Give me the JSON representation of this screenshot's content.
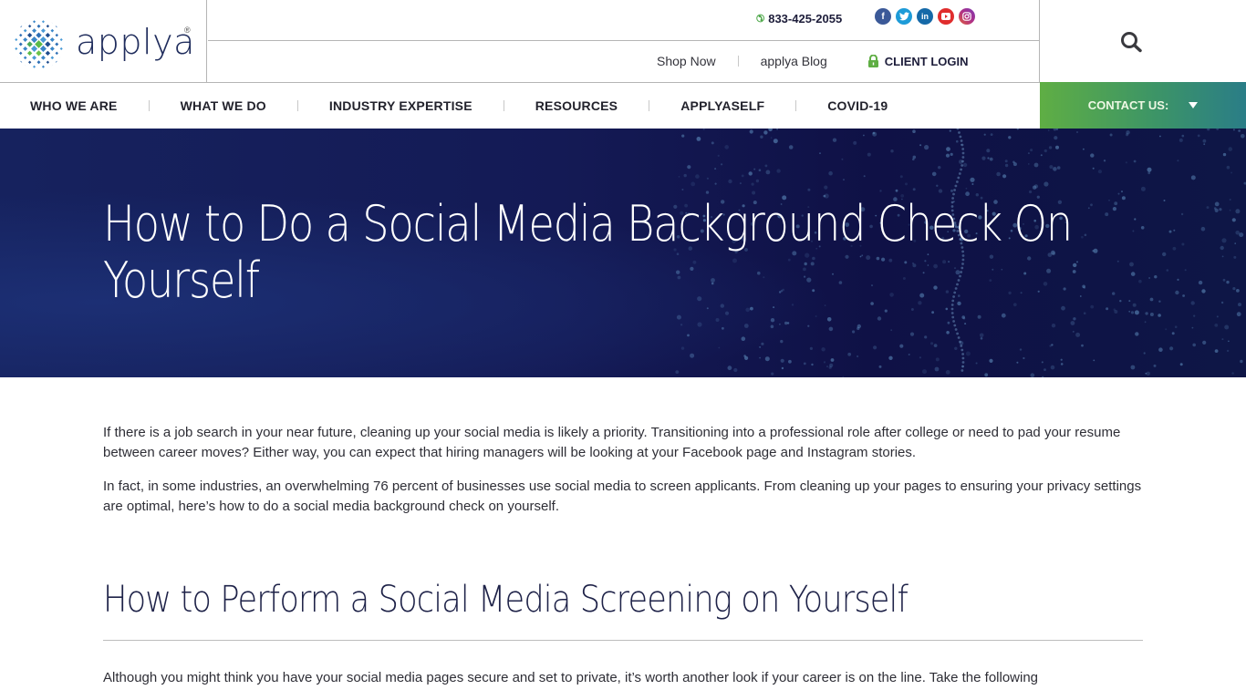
{
  "brand": {
    "name": "applya",
    "registered_mark": "®",
    "colors": {
      "navy": "#1f2c5c",
      "green": "#5fae44",
      "teal": "#2a7d87",
      "hero_dark": "#0f1146"
    }
  },
  "utility": {
    "phone_icon": "phone-icon",
    "phone": "833-425-2055",
    "socials": [
      {
        "name": "facebook",
        "glyph": "f",
        "color": "#3b5998"
      },
      {
        "name": "twitter",
        "glyph": "t",
        "color": "#1da1f2"
      },
      {
        "name": "linkedin",
        "glyph": "in",
        "color": "#0e76a8"
      },
      {
        "name": "youtube",
        "glyph": "▶",
        "color": "#e52d27"
      },
      {
        "name": "instagram",
        "glyph": "◎",
        "color": "#8a3ab9"
      }
    ],
    "links": [
      {
        "label": "Shop Now"
      },
      {
        "label": "applya Blog"
      }
    ],
    "client_login": "CLIENT LOGIN"
  },
  "nav": {
    "items": [
      {
        "label": "WHO WE ARE"
      },
      {
        "label": "WHAT WE DO"
      },
      {
        "label": "INDUSTRY EXPERTISE"
      },
      {
        "label": "RESOURCES"
      },
      {
        "label": "APPLYASELF"
      },
      {
        "label": "COVID-19"
      }
    ],
    "contact_label": "CONTACT US:"
  },
  "hero": {
    "title": "How to Do a Social Media Background Check On Yourself"
  },
  "article": {
    "paragraphs": [
      "If there is a job search in your near future, cleaning up your social media is likely a priority. Transitioning into a professional role after college or need to pad your resume between career moves? Either way, you can expect that hiring managers will be looking at your Facebook page and Instagram stories.",
      "In fact, in some industries, an overwhelming 76 percent of businesses use social media to screen applicants. From cleaning up your pages to ensuring your privacy settings are optimal, here’s how to do a social media background check on yourself."
    ],
    "section_heading": "How to Perform a Social Media Screening on Yourself",
    "section_paragraph": "Although you might think you have your social media pages secure and set to private, it’s worth another look if your career is on the line. Take the following"
  }
}
